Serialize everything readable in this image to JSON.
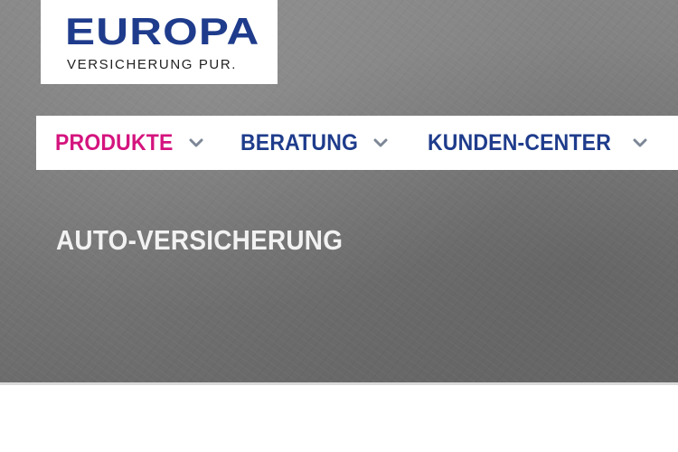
{
  "brand": {
    "name": "EUROPA",
    "tagline": "VERSICHERUNG PUR."
  },
  "nav": {
    "items": [
      {
        "label": "PRODUKTE",
        "active": true,
        "icon": "chevron-down-icon"
      },
      {
        "label": "BERATUNG",
        "active": false,
        "icon": "chevron-down-icon"
      },
      {
        "label": "KUNDEN-CENTER",
        "active": false,
        "icon": "chevron-down-icon"
      }
    ]
  },
  "hero": {
    "heading": "AUTO-VERSICHERUNG"
  },
  "colors": {
    "brand_blue": "#1f3c8c",
    "active_magenta": "#d4147e",
    "chevron_gray": "#7d8796",
    "heading_white": "#f2f2f2"
  }
}
